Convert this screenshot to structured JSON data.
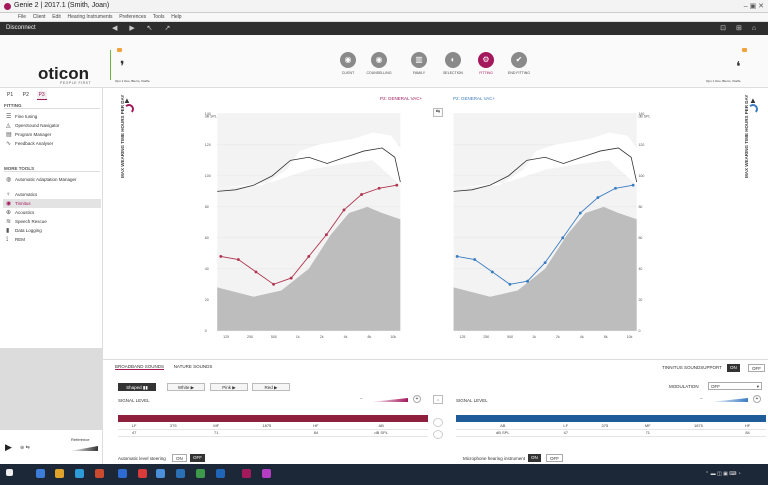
{
  "window": {
    "title": "Genie 2 | 2017.1 (Smith, Joan)",
    "controls": "‒ ▣ ✕"
  },
  "menu": [
    "File",
    "Client",
    "Edit",
    "Hearing Instruments",
    "Preferences",
    "Tools",
    "Help"
  ],
  "toolbar": {
    "disconnect_label": "Disconnect"
  },
  "brand": {
    "name": "oticon",
    "tagline": "PEOPLE FIRST"
  },
  "hearing_aid": {
    "left_label": "Opn 1 Ooo, Bterm, Vtorfle",
    "right_label": "Opn 1 Ooo, Bterm, Vtorfle"
  },
  "steps": [
    {
      "label": "CLIENT",
      "glyph": "◉"
    },
    {
      "label": "COUNSELLING",
      "glyph": "◉"
    },
    {
      "label": "FAMILY",
      "glyph": "▥"
    },
    {
      "label": "SELECTION",
      "glyph": "◐"
    },
    {
      "label": "FITTING",
      "glyph": "⚙"
    },
    {
      "label": "END FITTING",
      "glyph": "✔"
    }
  ],
  "program_tabs": [
    "P1",
    "P2",
    "P3"
  ],
  "sidebar": {
    "fitting_header": "FITTING",
    "fitting_items": [
      {
        "label": "Fine tuning",
        "icon": "☰"
      },
      {
        "label": "OpenSound Navigator",
        "icon": "◬"
      },
      {
        "label": "Program Manager",
        "icon": "▤"
      },
      {
        "label": "Feedback Analyser",
        "icon": "∿"
      }
    ],
    "more_header": "MORE TOOLS",
    "more_items": [
      {
        "label": "Automatic Adaptation Manager",
        "icon": "◍"
      },
      {
        "label": "Automatics",
        "icon": "♆"
      },
      {
        "label": "Tinnitus",
        "icon": "◉"
      },
      {
        "label": "Acoustics",
        "icon": "⊕"
      },
      {
        "label": "Speech Rescue",
        "icon": "≋"
      },
      {
        "label": "Data Logging",
        "icon": "▮"
      },
      {
        "label": "REM",
        "icon": "⟟"
      }
    ]
  },
  "vertical_label": "MAX WEARING TIME\nHOURS PER DAY",
  "left_chart_title": "P2: GENERAL VAC+",
  "right_chart_title": "P2: GENERAL VAC+",
  "bottom": {
    "tab_broadband": "BROADBAND SOUNDS",
    "tab_nature": "NATURE SOUNDS",
    "sound_buttons": [
      "Shaped",
      "White",
      "Pink",
      "Red"
    ],
    "tinnitus_support_label": "TINNITUS SOUNDSUPPORT",
    "on": "ON",
    "off": "OFF",
    "modulation_label": "MODULATION",
    "modulation_value": "OFF",
    "signal_level": "SIGNAL LEVEL",
    "auto_steering": "Automatic level steering",
    "mic_instrument": "Microphone hearing instrument",
    "reference": "Reference"
  },
  "chart_data": {
    "type": "line",
    "x_ticks": [
      "125",
      "250",
      "500",
      "1k",
      "2k",
      "4k",
      "8k",
      "10k"
    ],
    "y_ticks": [
      "140",
      "120",
      "100",
      "80",
      "60",
      "40",
      "20",
      "0"
    ],
    "y_unit": "dB SPL",
    "ylim": [
      0,
      140
    ],
    "series": [
      {
        "name": "left",
        "color": "#b0344f",
        "values": [
          48,
          46,
          38,
          30,
          34,
          48,
          62,
          78,
          88,
          92,
          94
        ]
      },
      {
        "name": "right",
        "color": "#3a7cc2",
        "values": [
          48,
          46,
          38,
          30,
          32,
          44,
          60,
          76,
          86,
          92,
          94
        ]
      }
    ]
  }
}
